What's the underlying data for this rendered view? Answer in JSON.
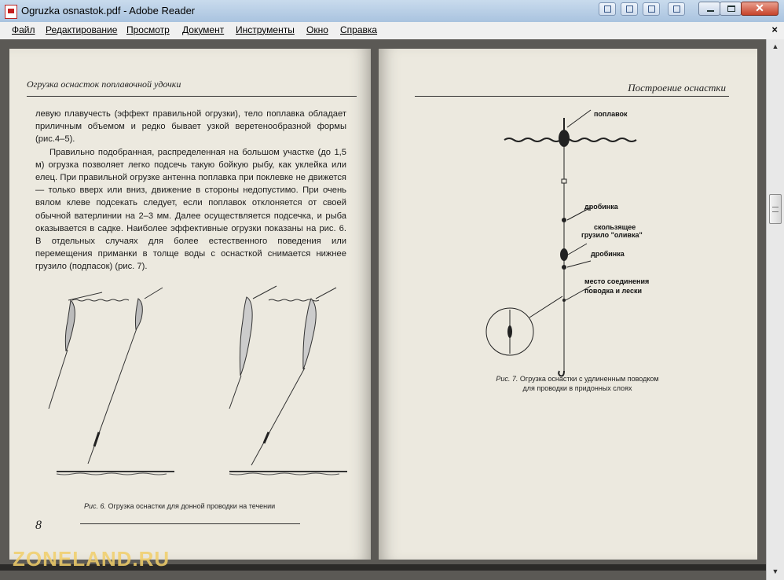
{
  "window": {
    "title": "Ogruzka osnastok.pdf - Adobe Reader"
  },
  "menu": {
    "items": [
      "Файл",
      "Редактирование",
      "Просмотр",
      "Документ",
      "Инструменты",
      "Окно",
      "Справка"
    ],
    "doc_close": "×"
  },
  "left_page": {
    "running_header": "Огрузка оснасток поплавочной удочки",
    "paragraphs": [
      "левую плавучесть (эффект правильной огрузки), тело поплавка обладает приличным объемом и редко бывает узкой веретенообразной формы (рис.4–5).",
      "Правильно подобранная, распределенная на большом участке (до 1,5 м) огрузка позволяет легко подсечь такую бойкую рыбу, как уклейка или елец. При правильной огрузке антенна поплавка при поклевке не движется — только вверх или вниз, движение в стороны недопустимо. При очень вялом клеве подсекать следует, если поплавок отклоняется от своей обычной ватерлинии на 2–3 мм. Далее осуществляется подсечка, и рыба оказывается в садке. Наиболее эффективные огрузки показаны на рис. 6. В отдельных случаях для более естественного поведения или перемещения приманки в толще воды с оснасткой снимается нижнее грузило (подпасок) (рис. 7)."
    ],
    "caption_prefix": "Рис. 6.",
    "caption": "Огрузка оснастки для донной проводки на течении",
    "page_number": "8"
  },
  "right_page": {
    "running_header": "Построение оснастки",
    "labels": {
      "float": "поплавок",
      "shot1": "дробинка",
      "olive_line1": "скользящее",
      "olive_line2": "грузило \"оливка\"",
      "shot2": "дробинка",
      "joint_line1": "место соединения",
      "joint_line2": "поводка и лески"
    },
    "caption_prefix": "Рис. 7.",
    "caption_line1": "Огрузка оснастки с удлиненным поводком",
    "caption_line2": "для проводки в придонных слоях"
  },
  "watermark": "ZONELAND.RU",
  "colors": {
    "title_bar": "#b9cfe6",
    "close_button": "#c7432a",
    "paper": "#ece9df",
    "viewer_bg": "#5b5955",
    "watermark": "#f2cf6a"
  }
}
